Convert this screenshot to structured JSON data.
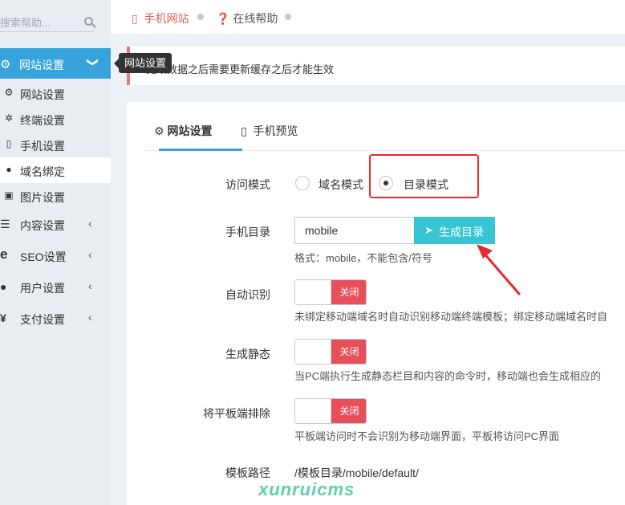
{
  "sidebar": {
    "search_placeholder": "搜索帮助...",
    "active_menu": {
      "label": "网站设置",
      "icon": "gear-icon"
    },
    "sub_items": [
      {
        "label": "网站设置",
        "icon": "gear-icon"
      },
      {
        "label": "终端设置",
        "icon": "gears-icon"
      },
      {
        "label": "手机设置",
        "icon": "mobile-icon"
      },
      {
        "label": "域名绑定",
        "icon": "globe-icon"
      },
      {
        "label": "图片设置",
        "icon": "image-icon"
      }
    ],
    "groups": [
      {
        "label": "内容设置",
        "icon": "list-icon"
      },
      {
        "label": "SEO设置",
        "icon": "ie-icon"
      },
      {
        "label": "用户设置",
        "icon": "user-icon"
      },
      {
        "label": "支付设置",
        "icon": "yen-icon"
      }
    ]
  },
  "tooltip": "网站设置",
  "breadcrumb": {
    "item1": "手机网站",
    "item2": "在线帮助"
  },
  "notice": "更改数据之后需要更新缓存之后才能生效",
  "tabs": {
    "tab1": "网站设置",
    "tab2": "手机预览"
  },
  "form": {
    "access_mode": {
      "label": "访问模式",
      "options": [
        "域名模式",
        "目录模式"
      ],
      "selected": "目录模式"
    },
    "mobile_dir": {
      "label": "手机目录",
      "value": "mobile",
      "button": "生成目录",
      "help": "格式：mobile，不能包含/符号"
    },
    "auto_detect": {
      "label": "自动识别",
      "state": "关闭",
      "help": "未绑定移动端域名时自动识别移动端终端模板；绑定移动端域名时自"
    },
    "gen_static": {
      "label": "生成静态",
      "state": "关闭",
      "help": "当PC端执行生成静态栏目和内容的命令时，移动端也会生成相应的"
    },
    "exclude_tablet": {
      "label": "将平板端排除",
      "state": "关闭",
      "help": "平板端访问时不会识别为移动端界面，平板将访问PC界面"
    },
    "template_path": {
      "label": "模板路径",
      "value": "/模板目录/mobile/default/"
    }
  },
  "watermark": "xunruicms",
  "colors": {
    "primary": "#36a3dc",
    "danger": "#e7505a",
    "info": "#36c6d3",
    "annotation": "#e4292f"
  }
}
